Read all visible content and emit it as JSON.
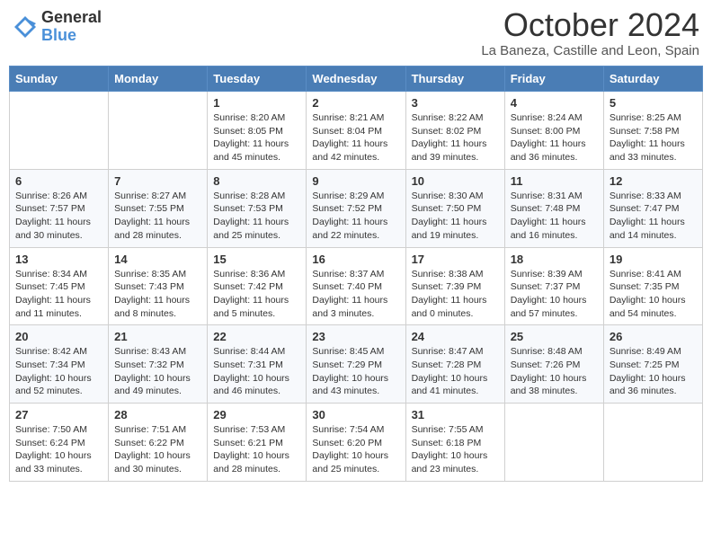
{
  "logo": {
    "general": "General",
    "blue": "Blue"
  },
  "title": "October 2024",
  "location": "La Baneza, Castille and Leon, Spain",
  "days_of_week": [
    "Sunday",
    "Monday",
    "Tuesday",
    "Wednesday",
    "Thursday",
    "Friday",
    "Saturday"
  ],
  "weeks": [
    [
      {
        "day": "",
        "info": ""
      },
      {
        "day": "",
        "info": ""
      },
      {
        "day": "1",
        "info": "Sunrise: 8:20 AM\nSunset: 8:05 PM\nDaylight: 11 hours and 45 minutes."
      },
      {
        "day": "2",
        "info": "Sunrise: 8:21 AM\nSunset: 8:04 PM\nDaylight: 11 hours and 42 minutes."
      },
      {
        "day": "3",
        "info": "Sunrise: 8:22 AM\nSunset: 8:02 PM\nDaylight: 11 hours and 39 minutes."
      },
      {
        "day": "4",
        "info": "Sunrise: 8:24 AM\nSunset: 8:00 PM\nDaylight: 11 hours and 36 minutes."
      },
      {
        "day": "5",
        "info": "Sunrise: 8:25 AM\nSunset: 7:58 PM\nDaylight: 11 hours and 33 minutes."
      }
    ],
    [
      {
        "day": "6",
        "info": "Sunrise: 8:26 AM\nSunset: 7:57 PM\nDaylight: 11 hours and 30 minutes."
      },
      {
        "day": "7",
        "info": "Sunrise: 8:27 AM\nSunset: 7:55 PM\nDaylight: 11 hours and 28 minutes."
      },
      {
        "day": "8",
        "info": "Sunrise: 8:28 AM\nSunset: 7:53 PM\nDaylight: 11 hours and 25 minutes."
      },
      {
        "day": "9",
        "info": "Sunrise: 8:29 AM\nSunset: 7:52 PM\nDaylight: 11 hours and 22 minutes."
      },
      {
        "day": "10",
        "info": "Sunrise: 8:30 AM\nSunset: 7:50 PM\nDaylight: 11 hours and 19 minutes."
      },
      {
        "day": "11",
        "info": "Sunrise: 8:31 AM\nSunset: 7:48 PM\nDaylight: 11 hours and 16 minutes."
      },
      {
        "day": "12",
        "info": "Sunrise: 8:33 AM\nSunset: 7:47 PM\nDaylight: 11 hours and 14 minutes."
      }
    ],
    [
      {
        "day": "13",
        "info": "Sunrise: 8:34 AM\nSunset: 7:45 PM\nDaylight: 11 hours and 11 minutes."
      },
      {
        "day": "14",
        "info": "Sunrise: 8:35 AM\nSunset: 7:43 PM\nDaylight: 11 hours and 8 minutes."
      },
      {
        "day": "15",
        "info": "Sunrise: 8:36 AM\nSunset: 7:42 PM\nDaylight: 11 hours and 5 minutes."
      },
      {
        "day": "16",
        "info": "Sunrise: 8:37 AM\nSunset: 7:40 PM\nDaylight: 11 hours and 3 minutes."
      },
      {
        "day": "17",
        "info": "Sunrise: 8:38 AM\nSunset: 7:39 PM\nDaylight: 11 hours and 0 minutes."
      },
      {
        "day": "18",
        "info": "Sunrise: 8:39 AM\nSunset: 7:37 PM\nDaylight: 10 hours and 57 minutes."
      },
      {
        "day": "19",
        "info": "Sunrise: 8:41 AM\nSunset: 7:35 PM\nDaylight: 10 hours and 54 minutes."
      }
    ],
    [
      {
        "day": "20",
        "info": "Sunrise: 8:42 AM\nSunset: 7:34 PM\nDaylight: 10 hours and 52 minutes."
      },
      {
        "day": "21",
        "info": "Sunrise: 8:43 AM\nSunset: 7:32 PM\nDaylight: 10 hours and 49 minutes."
      },
      {
        "day": "22",
        "info": "Sunrise: 8:44 AM\nSunset: 7:31 PM\nDaylight: 10 hours and 46 minutes."
      },
      {
        "day": "23",
        "info": "Sunrise: 8:45 AM\nSunset: 7:29 PM\nDaylight: 10 hours and 43 minutes."
      },
      {
        "day": "24",
        "info": "Sunrise: 8:47 AM\nSunset: 7:28 PM\nDaylight: 10 hours and 41 minutes."
      },
      {
        "day": "25",
        "info": "Sunrise: 8:48 AM\nSunset: 7:26 PM\nDaylight: 10 hours and 38 minutes."
      },
      {
        "day": "26",
        "info": "Sunrise: 8:49 AM\nSunset: 7:25 PM\nDaylight: 10 hours and 36 minutes."
      }
    ],
    [
      {
        "day": "27",
        "info": "Sunrise: 7:50 AM\nSunset: 6:24 PM\nDaylight: 10 hours and 33 minutes."
      },
      {
        "day": "28",
        "info": "Sunrise: 7:51 AM\nSunset: 6:22 PM\nDaylight: 10 hours and 30 minutes."
      },
      {
        "day": "29",
        "info": "Sunrise: 7:53 AM\nSunset: 6:21 PM\nDaylight: 10 hours and 28 minutes."
      },
      {
        "day": "30",
        "info": "Sunrise: 7:54 AM\nSunset: 6:20 PM\nDaylight: 10 hours and 25 minutes."
      },
      {
        "day": "31",
        "info": "Sunrise: 7:55 AM\nSunset: 6:18 PM\nDaylight: 10 hours and 23 minutes."
      },
      {
        "day": "",
        "info": ""
      },
      {
        "day": "",
        "info": ""
      }
    ]
  ]
}
